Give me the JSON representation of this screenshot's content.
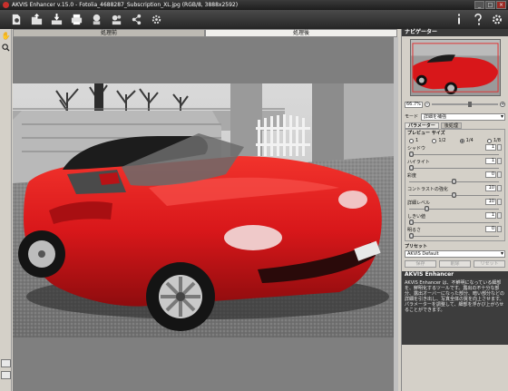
{
  "window": {
    "title": "AKVIS Enhancer v.15.0 - Fotolia_4688287_Subscription_XL.jpg (RGB/8, 3888x2592)"
  },
  "toolbar": {
    "left_icons": [
      "home-icon",
      "open-icon",
      "save-icon",
      "print-icon",
      "batch-icon",
      "settings-icon",
      "share-icon",
      "run-icon"
    ],
    "right_icons": [
      "info-icon",
      "help-icon",
      "preferences-icon"
    ]
  },
  "tabs": {
    "before": "処理前",
    "after": "処理後",
    "active": "after"
  },
  "navigator": {
    "title": "ナビゲーター",
    "zoom": "66.7%"
  },
  "mode": {
    "label": "モード",
    "value": "詳細を補強"
  },
  "params_tabs": {
    "parameters": "パラメーター",
    "post_processing": "後処理",
    "active": "parameters"
  },
  "preview": {
    "label": "プレビュー サイズ",
    "options": [
      "1",
      "1/2",
      "1/4",
      "1/8"
    ],
    "selected": "1/4"
  },
  "params": [
    {
      "label": "シャドウ",
      "value": "1",
      "level": 0.02
    },
    {
      "label": "ハイライト",
      "value": "1",
      "level": 0.02
    },
    {
      "label": "彩度",
      "value": "0",
      "level": 0.5
    },
    {
      "label": "コントラストの強化",
      "value": "10",
      "level": 0.5
    },
    {
      "label": "詳細レベル",
      "value": "10",
      "level": 0.2
    },
    {
      "label": "しきい値",
      "value": "1",
      "level": 0.02
    },
    {
      "label": "明るさ",
      "value": "0",
      "level": 0.02
    }
  ],
  "presets": {
    "label": "プリセット",
    "value": "AKVIS Default",
    "buttons": [
      "保存",
      "削除",
      "リセット"
    ]
  },
  "about": {
    "title": "AKVIS Enhancer",
    "text": "AKVIS Enhancer は、不鮮明になっている細部を、鮮明化するツールです。露出の不十分な部分、露出オーバーになった部分、暗い部分などの詳細を引き出し、写真全体の質を向上させます。パラメーターを調整して、細部を浮かび上がらせることができます。"
  },
  "colors": {
    "dark_bar": "#2b2b2b",
    "panel": "#d4d0c8",
    "canvas": "#7f7f7f",
    "car_red": "#d8171a"
  }
}
